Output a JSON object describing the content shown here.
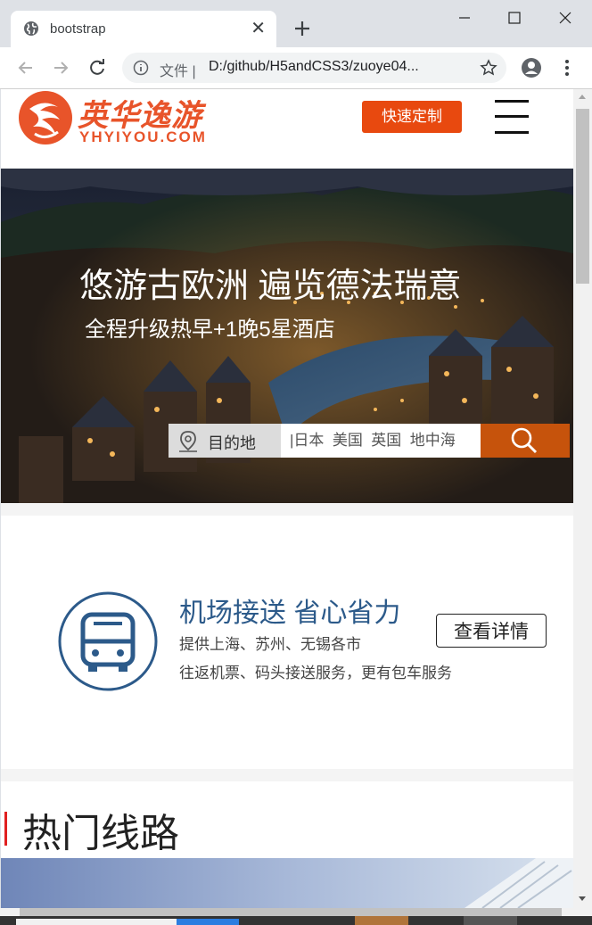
{
  "browser": {
    "tab_title": "bootstrap",
    "scheme_label": "文件",
    "url": "D:/github/H5andCSS3/zuoye04..."
  },
  "site": {
    "logo_cn": "英华逸游",
    "logo_en": "YHYIYOU.COM",
    "cta_label": "快速定制"
  },
  "hero": {
    "title": "悠游古欧洲 遍览德法瑞意",
    "subtitle": "全程升级热早+1晚5星酒店",
    "destination_label": "目的地",
    "search_placeholder": "|日本  美国  英国  地中海"
  },
  "service": {
    "title": "机场接送 省心省力",
    "line1": "提供上海、苏州、无锡各市",
    "line2": "往返机票、码头接送服务，更有包车服务",
    "detail_label": "查看详情"
  },
  "routes": {
    "title": "热门线路"
  },
  "colors": {
    "brand_orange": "#e8490f",
    "search_orange": "#c6530c",
    "service_blue": "#2c5a8a",
    "accent_red": "#e02020"
  }
}
